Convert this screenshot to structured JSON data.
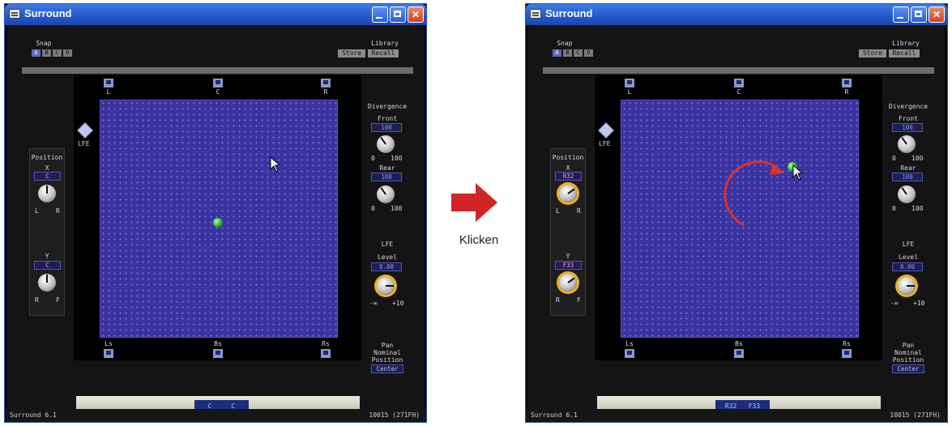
{
  "windows": [
    {
      "title": "Surround",
      "snap": {
        "label": "Snap",
        "buttons": [
          "A",
          "B",
          "C",
          "D"
        ]
      },
      "library": {
        "label": "Library",
        "store": "Store",
        "recall": "Recall"
      },
      "speakers": {
        "front": [
          "L",
          "C",
          "R"
        ],
        "rear": [
          "Ls",
          "Bs",
          "Rs"
        ],
        "lfe": "LFE"
      },
      "position": {
        "title": "Position",
        "x_label": "X",
        "x_value": "C",
        "lr_left": "L",
        "lr_right": "R",
        "y_label": "Y",
        "y_value": "C",
        "rf_left": "R",
        "rf_right": "F"
      },
      "divergence": {
        "title": "Divergence",
        "front_label": "Front",
        "front_value": "100",
        "rear_label": "Rear",
        "rear_value": "100",
        "min": "0",
        "max": "100"
      },
      "lfe": {
        "title": "LFE",
        "level_label": "Level",
        "level_value": "0.00",
        "min": "-∞",
        "max": "+10"
      },
      "pan": {
        "line1": "Pan",
        "line2": "Nominal",
        "line3": "Position",
        "value": "Center"
      },
      "bottom_pos": {
        "x": "C",
        "y": "C"
      },
      "status": {
        "left": "Surround   6.1",
        "right": "10015 (271FH)"
      }
    },
    {
      "title": "Surround",
      "snap": {
        "label": "Snap",
        "buttons": [
          "A",
          "B",
          "C",
          "D"
        ]
      },
      "library": {
        "label": "Library",
        "store": "Store",
        "recall": "Recall"
      },
      "speakers": {
        "front": [
          "L",
          "C",
          "R"
        ],
        "rear": [
          "Ls",
          "Bs",
          "Rs"
        ],
        "lfe": "LFE"
      },
      "position": {
        "title": "Position",
        "x_label": "X",
        "x_value": "R32",
        "lr_left": "L",
        "lr_right": "R",
        "y_label": "Y",
        "y_value": "F33",
        "rf_left": "R",
        "rf_right": "F"
      },
      "divergence": {
        "title": "Divergence",
        "front_label": "Front",
        "front_value": "100",
        "rear_label": "Rear",
        "rear_value": "100",
        "min": "0",
        "max": "100"
      },
      "lfe": {
        "title": "LFE",
        "level_label": "Level",
        "level_value": "0.00",
        "min": "-∞",
        "max": "+10"
      },
      "pan": {
        "line1": "Pan",
        "line2": "Nominal",
        "line3": "Position",
        "value": "Center"
      },
      "bottom_pos": {
        "x": "R32",
        "y": "F33"
      },
      "status": {
        "left": "Surround   6.1",
        "right": "10015 (271FH)"
      }
    }
  ],
  "caption": "Klicken",
  "colors": {
    "arrow": "#d22424",
    "grid": "#3b33a0",
    "dot": "#1fa02a",
    "knob_arc": "#f0b020"
  }
}
